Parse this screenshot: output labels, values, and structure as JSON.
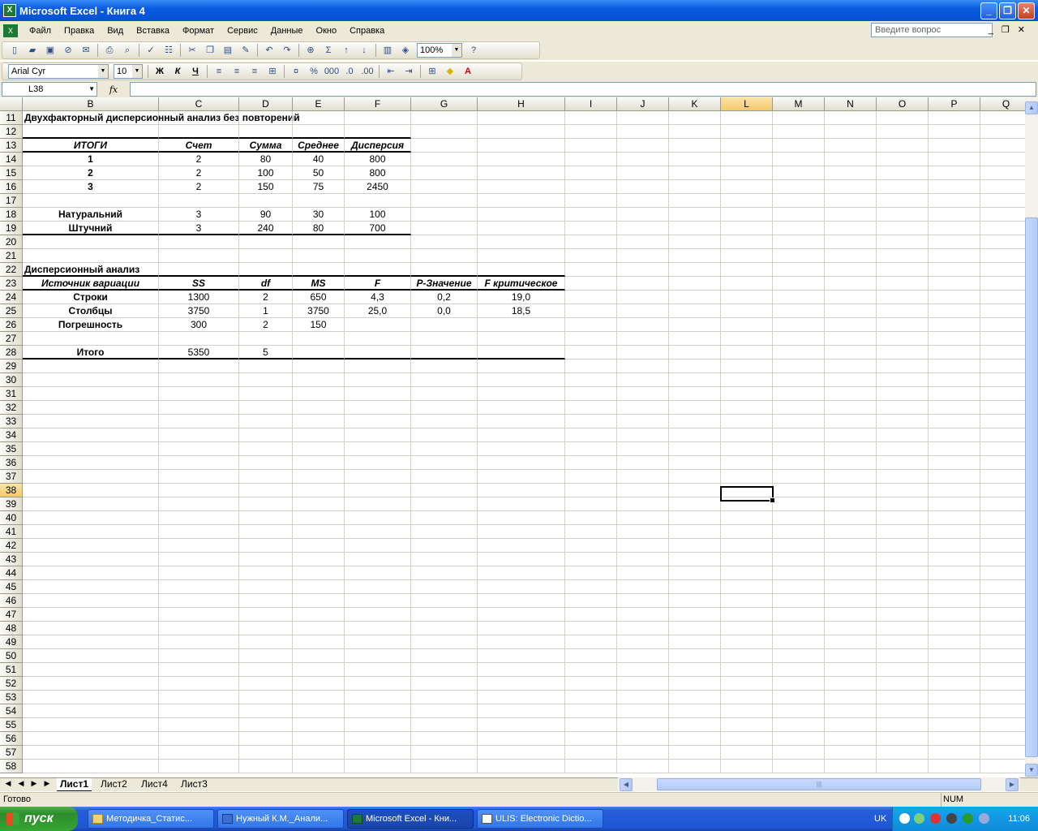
{
  "window": {
    "title": "Microsoft Excel - Книга 4"
  },
  "menu": {
    "items": [
      "Файл",
      "Правка",
      "Вид",
      "Вставка",
      "Формат",
      "Сервис",
      "Данные",
      "Окно",
      "Справка"
    ],
    "help_placeholder": "Введите вопрос"
  },
  "toolbar": {
    "zoom": "100%",
    "font": "Arial Cyr",
    "size": "10",
    "bold": "Ж",
    "italic": "К",
    "underline": "Ч",
    "sigma": "Σ"
  },
  "namebox": {
    "cell": "L38"
  },
  "columns": [
    {
      "id": "B",
      "w": 168
    },
    {
      "id": "C",
      "w": 99
    },
    {
      "id": "D",
      "w": 66
    },
    {
      "id": "E",
      "w": 64
    },
    {
      "id": "F",
      "w": 82
    },
    {
      "id": "G",
      "w": 82
    },
    {
      "id": "H",
      "w": 108
    },
    {
      "id": "I",
      "w": 64
    },
    {
      "id": "J",
      "w": 64
    },
    {
      "id": "K",
      "w": 64
    },
    {
      "id": "L",
      "w": 64
    },
    {
      "id": "M",
      "w": 64
    },
    {
      "id": "N",
      "w": 64
    },
    {
      "id": "O",
      "w": 64
    },
    {
      "id": "P",
      "w": 64
    },
    {
      "id": "Q",
      "w": 64
    }
  ],
  "selected": {
    "col": "L",
    "row": 38
  },
  "cells": {
    "11": {
      "B": {
        "v": "Двухфакторный дисперсионный анализ без повторений",
        "s": "b l"
      }
    },
    "13": {
      "B": {
        "v": "ИТОГИ",
        "s": "bi"
      },
      "C": {
        "v": "Счет",
        "s": "bi"
      },
      "D": {
        "v": "Сумма",
        "s": "bi"
      },
      "E": {
        "v": "Среднее",
        "s": "bi"
      },
      "F": {
        "v": "Дисперсия",
        "s": "bi"
      }
    },
    "14": {
      "B": {
        "v": "1",
        "s": "b"
      },
      "C": {
        "v": "2"
      },
      "D": {
        "v": "80"
      },
      "E": {
        "v": "40"
      },
      "F": {
        "v": "800"
      }
    },
    "15": {
      "B": {
        "v": "2",
        "s": "b"
      },
      "C": {
        "v": "2"
      },
      "D": {
        "v": "100"
      },
      "E": {
        "v": "50"
      },
      "F": {
        "v": "800"
      }
    },
    "16": {
      "B": {
        "v": "3",
        "s": "b"
      },
      "C": {
        "v": "2"
      },
      "D": {
        "v": "150"
      },
      "E": {
        "v": "75"
      },
      "F": {
        "v": "2450"
      }
    },
    "18": {
      "B": {
        "v": "Натуральний",
        "s": "b"
      },
      "C": {
        "v": "3"
      },
      "D": {
        "v": "90"
      },
      "E": {
        "v": "30"
      },
      "F": {
        "v": "100"
      }
    },
    "19": {
      "B": {
        "v": "Штучний",
        "s": "b"
      },
      "C": {
        "v": "3"
      },
      "D": {
        "v": "240"
      },
      "E": {
        "v": "80"
      },
      "F": {
        "v": "700"
      }
    },
    "22": {
      "B": {
        "v": "Дисперсионный анализ",
        "s": "b l"
      }
    },
    "23": {
      "B": {
        "v": "Источник вариации",
        "s": "bi"
      },
      "C": {
        "v": "SS",
        "s": "bi"
      },
      "D": {
        "v": "df",
        "s": "bi"
      },
      "E": {
        "v": "MS",
        "s": "bi"
      },
      "F": {
        "v": "F",
        "s": "bi"
      },
      "G": {
        "v": "P-Значение",
        "s": "bi"
      },
      "H": {
        "v": "F критическое",
        "s": "bi"
      }
    },
    "24": {
      "B": {
        "v": "Строки",
        "s": "b"
      },
      "C": {
        "v": "1300"
      },
      "D": {
        "v": "2"
      },
      "E": {
        "v": "650"
      },
      "F": {
        "v": "4,3"
      },
      "G": {
        "v": "0,2"
      },
      "H": {
        "v": "19,0"
      }
    },
    "25": {
      "B": {
        "v": "Столбцы",
        "s": "b"
      },
      "C": {
        "v": "3750"
      },
      "D": {
        "v": "1"
      },
      "E": {
        "v": "3750"
      },
      "F": {
        "v": "25,0"
      },
      "G": {
        "v": "0,0"
      },
      "H": {
        "v": "18,5"
      }
    },
    "26": {
      "B": {
        "v": "Погрешность",
        "s": "b"
      },
      "C": {
        "v": "300"
      },
      "D": {
        "v": "2"
      },
      "E": {
        "v": "150"
      }
    },
    "28": {
      "B": {
        "v": "Итого",
        "s": "b"
      },
      "C": {
        "v": "5350"
      },
      "D": {
        "v": "5"
      }
    }
  },
  "sheets": {
    "tabs": [
      "Лист1",
      "Лист2",
      "Лист4",
      "Лист3"
    ],
    "active": 0
  },
  "status": {
    "text": "Готово",
    "num": "NUM"
  },
  "taskbar": {
    "start": "пуск",
    "tasks": [
      "Методичка_Статис...",
      "Нужный К.М._Анали...",
      "Microsoft Excel - Кни...",
      "ULIS: Electronic Dictio..."
    ],
    "active": 2,
    "lang": "UK",
    "clock": "11:06"
  }
}
